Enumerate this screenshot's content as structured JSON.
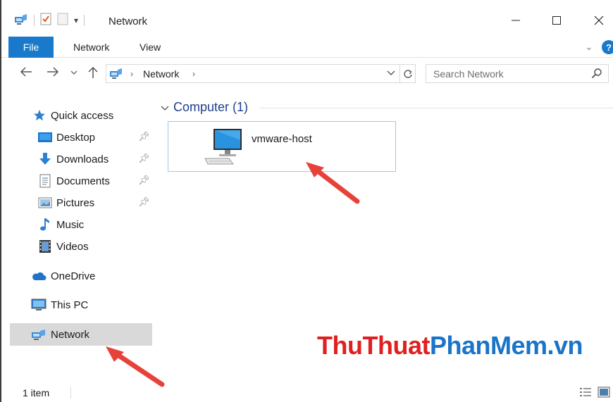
{
  "window": {
    "title": "Network"
  },
  "ribbon": {
    "tabs": [
      "File",
      "Network",
      "View"
    ]
  },
  "address": {
    "crumb": "Network",
    "search_placeholder": "Search Network"
  },
  "sidebar": {
    "items": [
      {
        "label": "Quick access",
        "icon": "star-icon"
      },
      {
        "label": "Desktop",
        "icon": "desktop-folder-icon",
        "pinned": true
      },
      {
        "label": "Downloads",
        "icon": "download-arrow-icon",
        "pinned": true
      },
      {
        "label": "Documents",
        "icon": "document-icon",
        "pinned": true
      },
      {
        "label": "Pictures",
        "icon": "picture-icon",
        "pinned": true
      },
      {
        "label": "Music",
        "icon": "music-note-icon"
      },
      {
        "label": "Videos",
        "icon": "film-icon"
      },
      {
        "label": "OneDrive",
        "icon": "cloud-icon"
      },
      {
        "label": "This PC",
        "icon": "monitor-icon"
      },
      {
        "label": "Network",
        "icon": "network-icon",
        "selected": true
      }
    ]
  },
  "content": {
    "group_label": "Computer (1)",
    "items": [
      {
        "name": "vmware-host",
        "icon": "computer-icon"
      }
    ]
  },
  "status": {
    "item_count": "1 item"
  },
  "watermark": {
    "part1": "Thu",
    "part2": "Thuat",
    "part3": "Phan",
    "part4": "Mem",
    "part5": ".vn"
  },
  "colors": {
    "accent": "#1979ca",
    "selection": "#d9d9d9",
    "tile_border": "#99c9ef",
    "arrow": "#e8413a"
  }
}
